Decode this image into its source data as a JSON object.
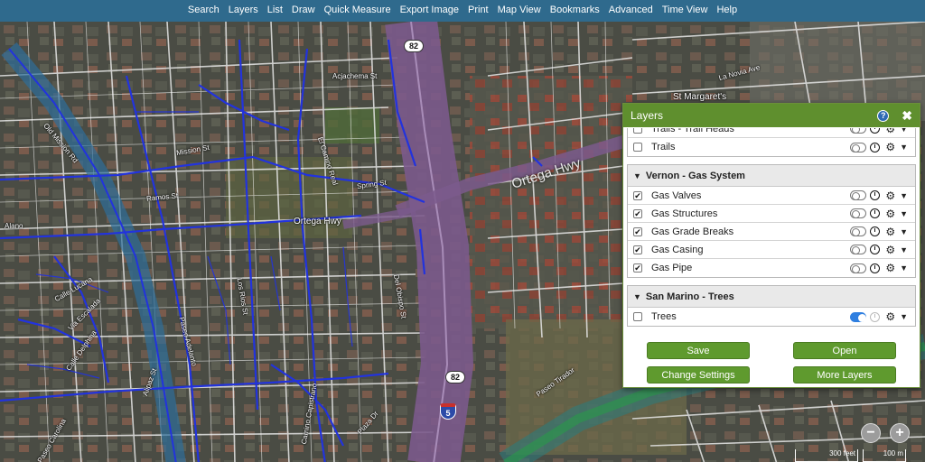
{
  "nav": [
    "Search",
    "Layers",
    "List",
    "Draw",
    "Quick Measure",
    "Export Image",
    "Print",
    "Map View",
    "Bookmarks",
    "Advanced",
    "Time View",
    "Help"
  ],
  "map": {
    "labels": {
      "ortega_hwy_main": "Ortega Hwy",
      "ortega_hwy_small": "Ortega Hwy",
      "mission_st": "Mission St",
      "ramos_st": "Ramos St",
      "spring_st": "Spring St",
      "el_camino_real": "El Camino Real",
      "del_obispo": "Del Obispo St",
      "los_rios": "Los Rios St",
      "paseo_adelanto": "Paseo Adelanto",
      "camino_capistrano": "Camino Capistrano",
      "plaza_dr": "Plaza Dr",
      "calle_lucana": "Calle Lucana",
      "via_escalada": "Via Escalada",
      "calle_delphina": "Calle Delphina",
      "paseo_carolina": "Paseo Carolina",
      "alipaz": "Alipaz St",
      "st_margarets": "St Margaret's",
      "la_novia": "La Novia Ave",
      "paseo_tirador": "Paseo Tirador",
      "alano": "Alano",
      "old_mission": "Old Mission Rd",
      "acjachema": "Acjachema St"
    },
    "shields": {
      "route82_top": "82",
      "route82_bottom": "82",
      "i5": "5"
    },
    "scale": {
      "feet": "300 feet",
      "meters": "100 m"
    },
    "zoom": {
      "out": "−",
      "in": "+"
    }
  },
  "layers_panel": {
    "title": "Layers",
    "help_glyph": "?",
    "close_glyph": "✖",
    "groups": [
      {
        "title": "",
        "clipped": true,
        "layers": [
          {
            "name": "Trails - Trail Heads",
            "checked": false,
            "toggle_on": false
          },
          {
            "name": "Trails",
            "checked": false,
            "toggle_on": false
          }
        ]
      },
      {
        "title": "Vernon - Gas System",
        "clipped": false,
        "layers": [
          {
            "name": "Gas Valves",
            "checked": true,
            "toggle_on": false
          },
          {
            "name": "Gas Structures",
            "checked": true,
            "toggle_on": false
          },
          {
            "name": "Gas Grade Breaks",
            "checked": true,
            "toggle_on": false
          },
          {
            "name": "Gas Casing",
            "checked": true,
            "toggle_on": false
          },
          {
            "name": "Gas Pipe",
            "checked": true,
            "toggle_on": false
          }
        ]
      },
      {
        "title": "San Marino - Trees",
        "clipped": false,
        "layers": [
          {
            "name": "Trees",
            "checked": false,
            "toggle_on": true
          }
        ]
      }
    ],
    "buttons": {
      "save": "Save",
      "open": "Open",
      "change_settings": "Change Settings",
      "more_layers": "More Layers"
    }
  },
  "colors": {
    "nav_bg": "#2f6a8d",
    "panel_header": "#5f8f2e",
    "button_green": "#5f9a2e",
    "freeway": "#7b5a8c",
    "gas_pipe": "#2233dd",
    "creek": "#2f6aa0"
  }
}
